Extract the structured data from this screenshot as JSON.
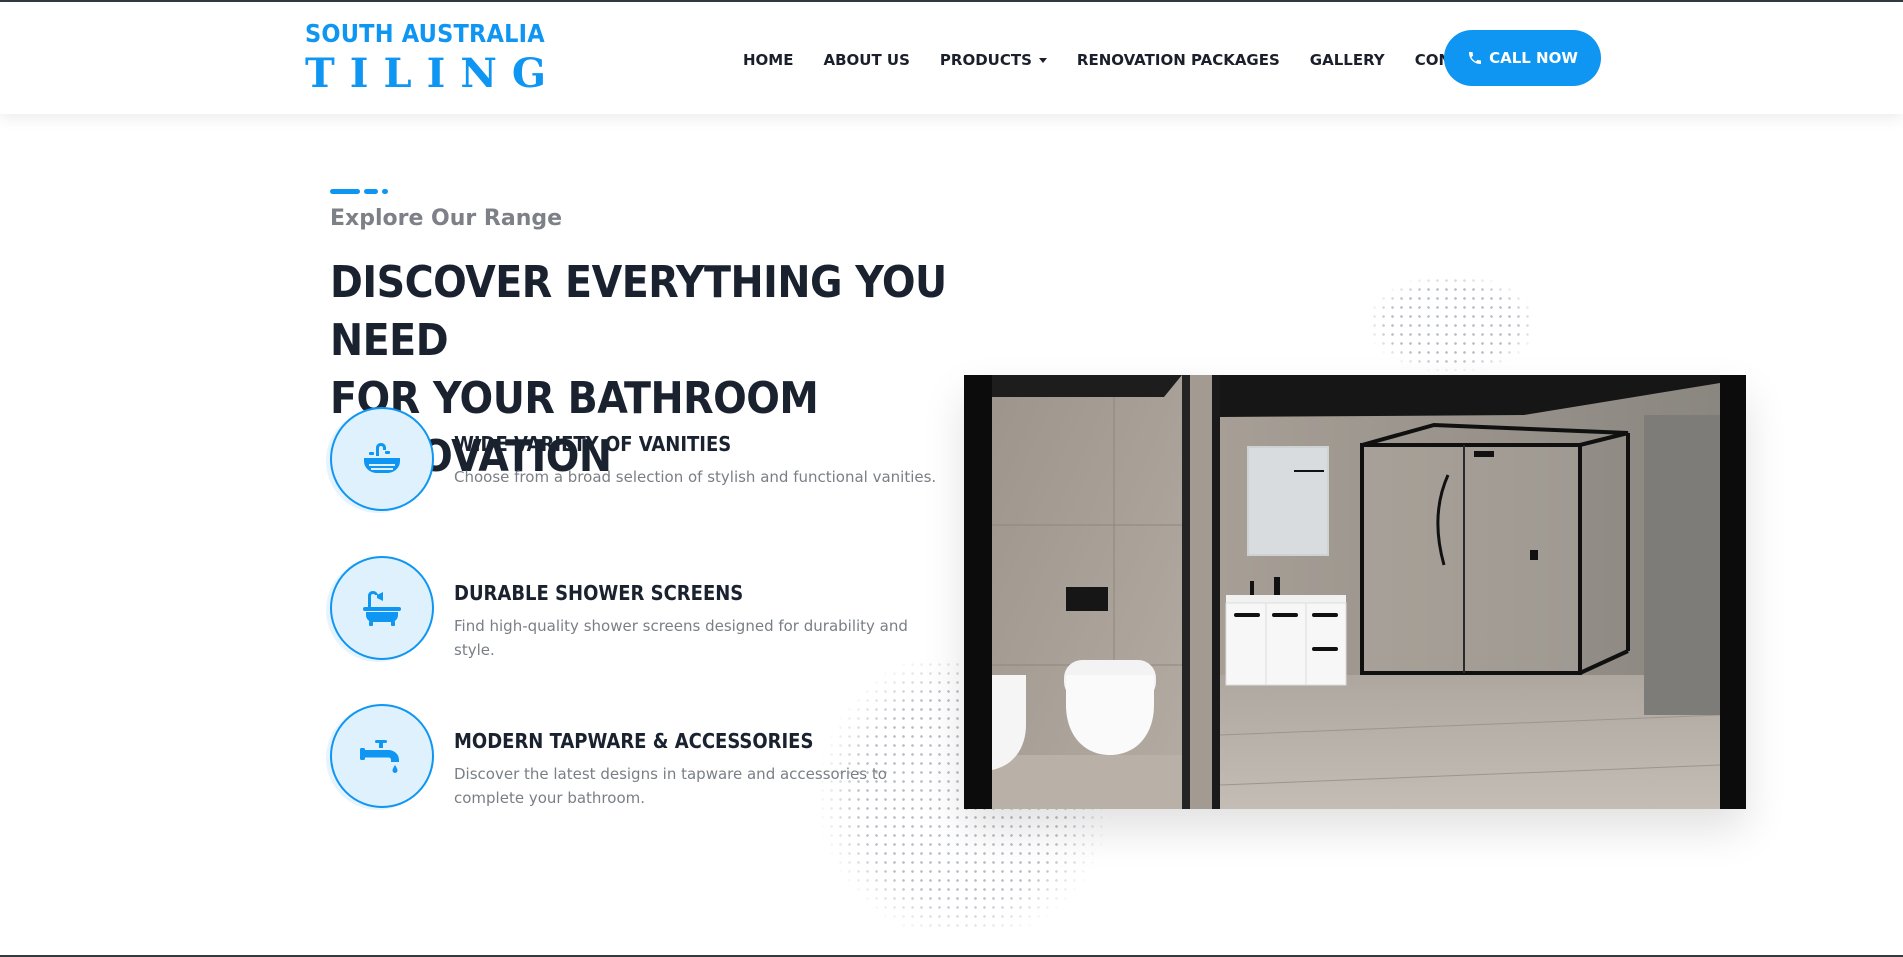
{
  "brand": {
    "line1": "SOUTH AUSTRALIA",
    "line2": "TILING",
    "accent": "#0f96f2"
  },
  "nav": {
    "items": [
      {
        "label": "HOME"
      },
      {
        "label": "ABOUT US"
      },
      {
        "label": "PRODUCTS",
        "dropdown": true
      },
      {
        "label": "RENOVATION PACKAGES"
      },
      {
        "label": "GALLERY"
      },
      {
        "label": "CONTACT"
      }
    ],
    "cta": {
      "label": "CALL NOW",
      "icon": "phone-icon"
    }
  },
  "section": {
    "eyebrow": "Explore Our Range",
    "heading_line1": "DISCOVER EVERYTHING YOU NEED",
    "heading_line2": "FOR YOUR BATHROOM RENOVATION"
  },
  "features": [
    {
      "icon": "vanity-sink-icon",
      "title": "WIDE VARIETY OF VANITIES",
      "desc": "Choose from a broad selection of stylish and functional vanities."
    },
    {
      "icon": "bathtub-shower-icon",
      "title": "DURABLE SHOWER SCREENS",
      "desc": "Find high-quality shower screens designed for durability and style."
    },
    {
      "icon": "faucet-icon",
      "title": "MODERN TAPWARE & ACCESSORIES",
      "desc": "Discover the latest designs in tapware and accessories to complete your bathroom."
    }
  ],
  "image": {
    "subject": "bathroom-interior-photo"
  }
}
